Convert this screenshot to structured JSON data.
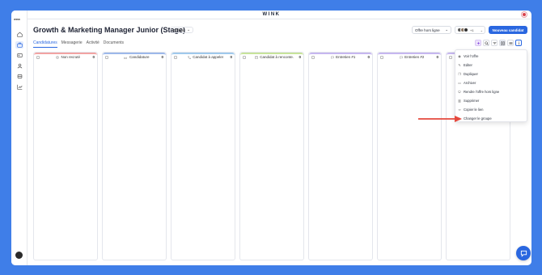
{
  "app": {
    "logo": "WINK",
    "brand_small": "WINK"
  },
  "header": {
    "title": "Growth & Marketing Manager Junior (Stage)",
    "location": "0 Paris",
    "status_select": "Offre hors ligne",
    "avatars_extra": "+1",
    "new_button": "Nouveau candidat"
  },
  "tabs": [
    "Candidatures",
    "Messagerie",
    "Activité",
    "Documents"
  ],
  "columns": [
    {
      "name": "Non recruté",
      "count": "0",
      "color": "#f2a3a3",
      "icon": "x-circle-icon"
    },
    {
      "name": "Candidature",
      "count": "0",
      "color": "#9db8ea",
      "icon": "inbox-icon"
    },
    {
      "name": "Candidat à appeler",
      "count": "0",
      "color": "#9fc9ec",
      "icon": "phone-icon"
    },
    {
      "name": "Candidat à renconte...",
      "count": "0",
      "color": "#c7e39a",
      "icon": "calendar-icon"
    },
    {
      "name": "Entretien #1",
      "count": "0",
      "color": "#c6b6ef",
      "icon": "chat-icon"
    },
    {
      "name": "Entretien #2",
      "count": "0",
      "color": "#c6b6ef",
      "icon": "chat-icon"
    },
    {
      "name": "",
      "count": "",
      "color": "#c6b6ef",
      "icon": ""
    }
  ],
  "menu": {
    "items": [
      {
        "label": "Voir l'offre",
        "icon": "eye-icon"
      },
      {
        "label": "Editer",
        "icon": "pencil-icon"
      },
      {
        "label": "Dupliquer",
        "icon": "copy-icon"
      },
      {
        "label": "Archiver",
        "icon": "archive-icon"
      },
      {
        "label": "Rendre l'offre hors ligne",
        "icon": "power-icon"
      },
      {
        "label": "Supprimer",
        "icon": "trash-icon"
      },
      {
        "label": "Copier le lien",
        "icon": "link-icon"
      },
      {
        "label": "Changer le groupe",
        "icon": "tag-icon"
      }
    ]
  },
  "colors": {
    "accent": "#2a67e0",
    "background": "#3f7ee8",
    "arrow": "#e5483d"
  }
}
